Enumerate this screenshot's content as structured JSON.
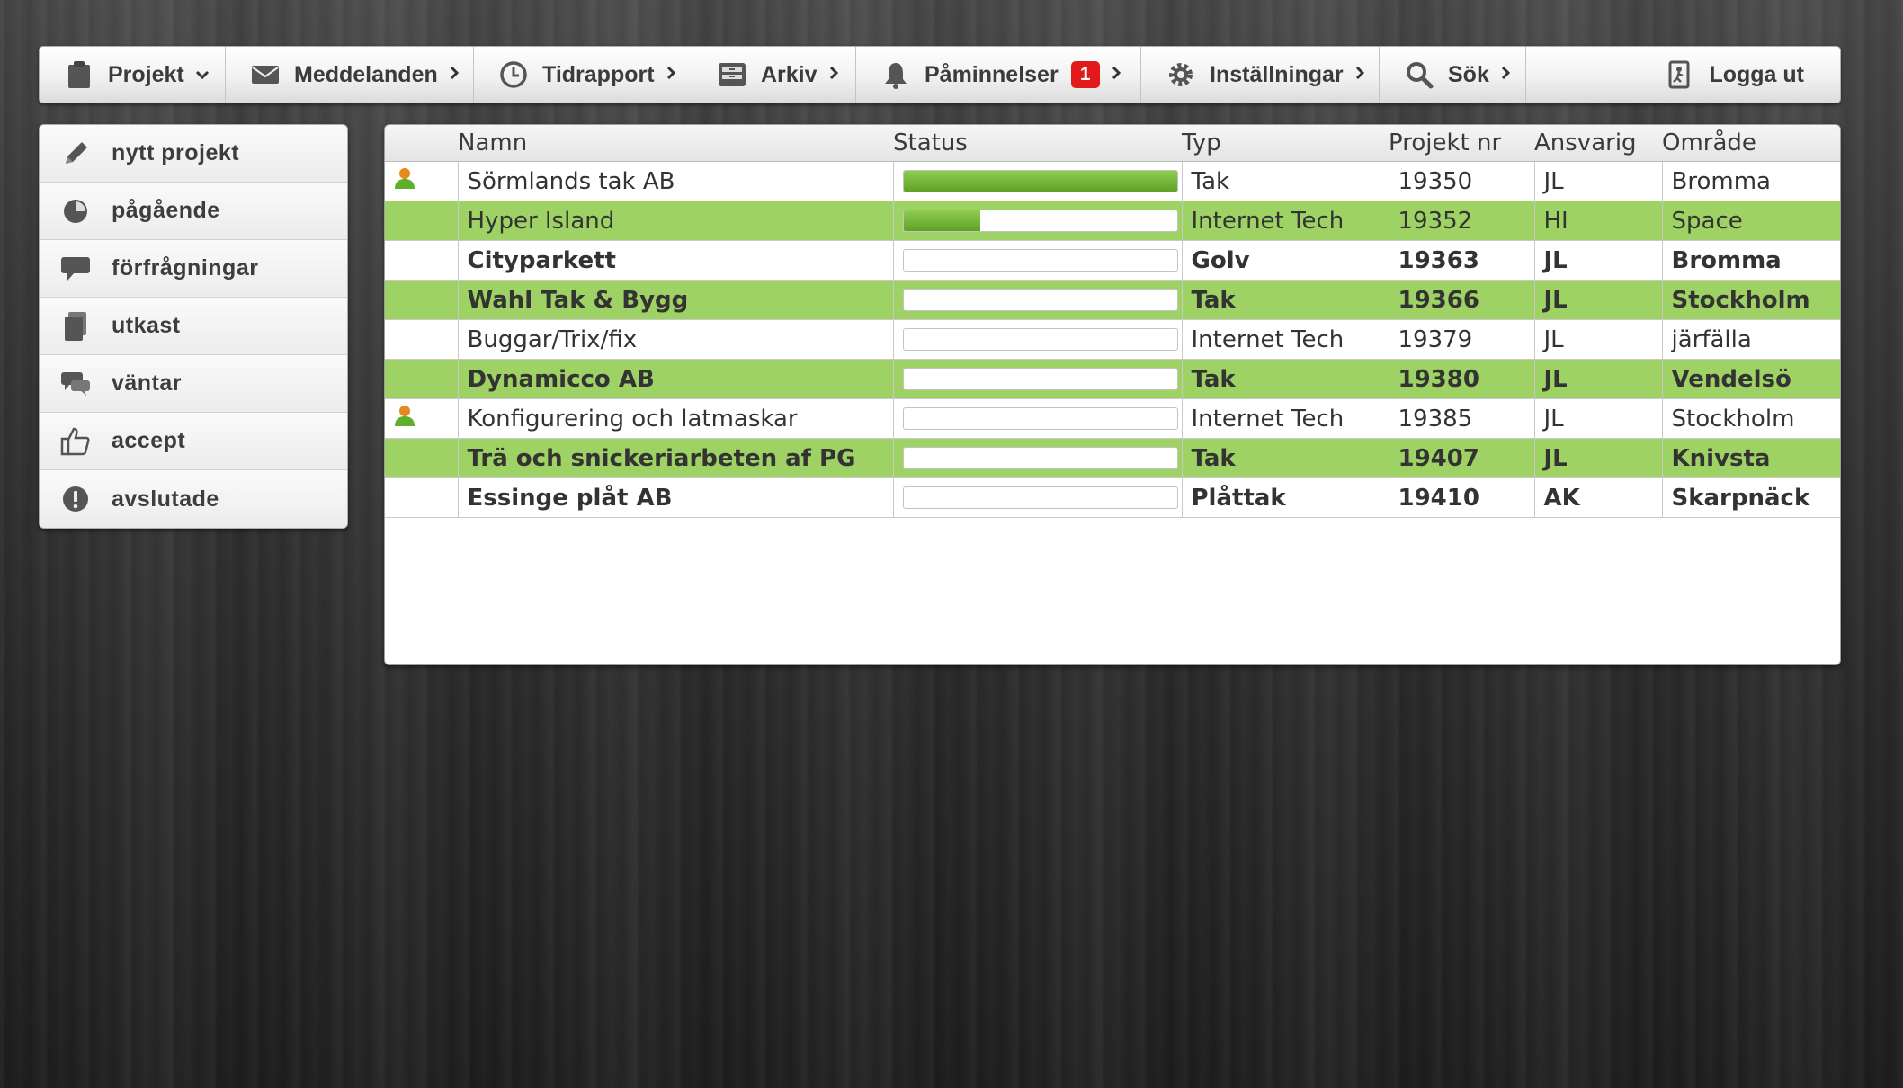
{
  "topnav": {
    "items": [
      {
        "label": "Projekt",
        "icon": "clipboard-icon",
        "chevron": "▾"
      },
      {
        "label": "Meddelanden",
        "icon": "envelope-icon",
        "chevron": "›"
      },
      {
        "label": "Tidrapport",
        "icon": "clock-icon",
        "chevron": "›"
      },
      {
        "label": "Arkiv",
        "icon": "archive-icon",
        "chevron": "›"
      },
      {
        "label": "Påminnelser",
        "icon": "bell-icon",
        "badge": "1",
        "chevron": "›"
      },
      {
        "label": "Inställningar",
        "icon": "gear-icon",
        "chevron": "›"
      },
      {
        "label": "Sök",
        "icon": "search-icon",
        "chevron": "›"
      },
      {
        "label": "Logga ut",
        "icon": "logout-icon"
      }
    ]
  },
  "sidebar": {
    "items": [
      {
        "label": "nytt projekt",
        "icon": "pencil-icon"
      },
      {
        "label": "pågående",
        "icon": "pie-icon"
      },
      {
        "label": "förfrågningar",
        "icon": "speech-bubble-icon"
      },
      {
        "label": "utkast",
        "icon": "draft-icon"
      },
      {
        "label": "väntar",
        "icon": "chat-bubbles-icon"
      },
      {
        "label": "accept",
        "icon": "thumbs-up-icon"
      },
      {
        "label": "avslutade",
        "icon": "exclamation-icon"
      }
    ]
  },
  "table": {
    "headers": {
      "mark": "",
      "name": "Namn",
      "status": "Status",
      "type": "Typ",
      "nr": "Projekt nr",
      "owner": "Ansvarig",
      "area": "Område"
    },
    "rows": [
      {
        "user": true,
        "name": "Sörmlands tak AB",
        "progress": 1.0,
        "type": "Tak",
        "nr": "19350",
        "owner": "JL",
        "area": "Bromma",
        "highlight": false,
        "bold": false
      },
      {
        "user": false,
        "name": "Hyper Island",
        "progress": 0.28,
        "type": "Internet Tech",
        "nr": "19352",
        "owner": "HI",
        "area": "Space",
        "highlight": true,
        "bold": false
      },
      {
        "user": false,
        "name": "Cityparkett",
        "progress": 0,
        "type": "Golv",
        "nr": "19363",
        "owner": "JL",
        "area": "Bromma",
        "highlight": false,
        "bold": true
      },
      {
        "user": false,
        "name": "Wahl Tak & Bygg",
        "progress": 0,
        "type": "Tak",
        "nr": "19366",
        "owner": "JL",
        "area": "Stockholm",
        "highlight": true,
        "bold": true
      },
      {
        "user": false,
        "name": "Buggar/Trix/fix",
        "progress": 0,
        "type": "Internet Tech",
        "nr": "19379",
        "owner": "JL",
        "area": "järfälla",
        "highlight": false,
        "bold": false
      },
      {
        "user": false,
        "name": "Dynamicco AB",
        "progress": 0,
        "type": "Tak",
        "nr": "19380",
        "owner": "JL",
        "area": "Vendelsö",
        "highlight": true,
        "bold": true
      },
      {
        "user": true,
        "name": "Konfigurering och latmaskar",
        "progress": 0,
        "type": "Internet Tech",
        "nr": "19385",
        "owner": "JL",
        "area": "Stockholm",
        "highlight": false,
        "bold": false
      },
      {
        "user": false,
        "name": "Trä och snickeriarbeten af PG",
        "progress": 0,
        "type": "Tak",
        "nr": "19407",
        "owner": "JL",
        "area": "Knivsta",
        "highlight": true,
        "bold": true
      },
      {
        "user": false,
        "name": "Essinge plåt AB",
        "progress": 0,
        "type": "Plåttak",
        "nr": "19410",
        "owner": "AK",
        "area": "Skarpnäck",
        "highlight": false,
        "bold": true
      }
    ]
  },
  "colors": {
    "row_highlight": "#9fd264",
    "progress": "#6bb12f",
    "badge": "#e21a1a"
  }
}
